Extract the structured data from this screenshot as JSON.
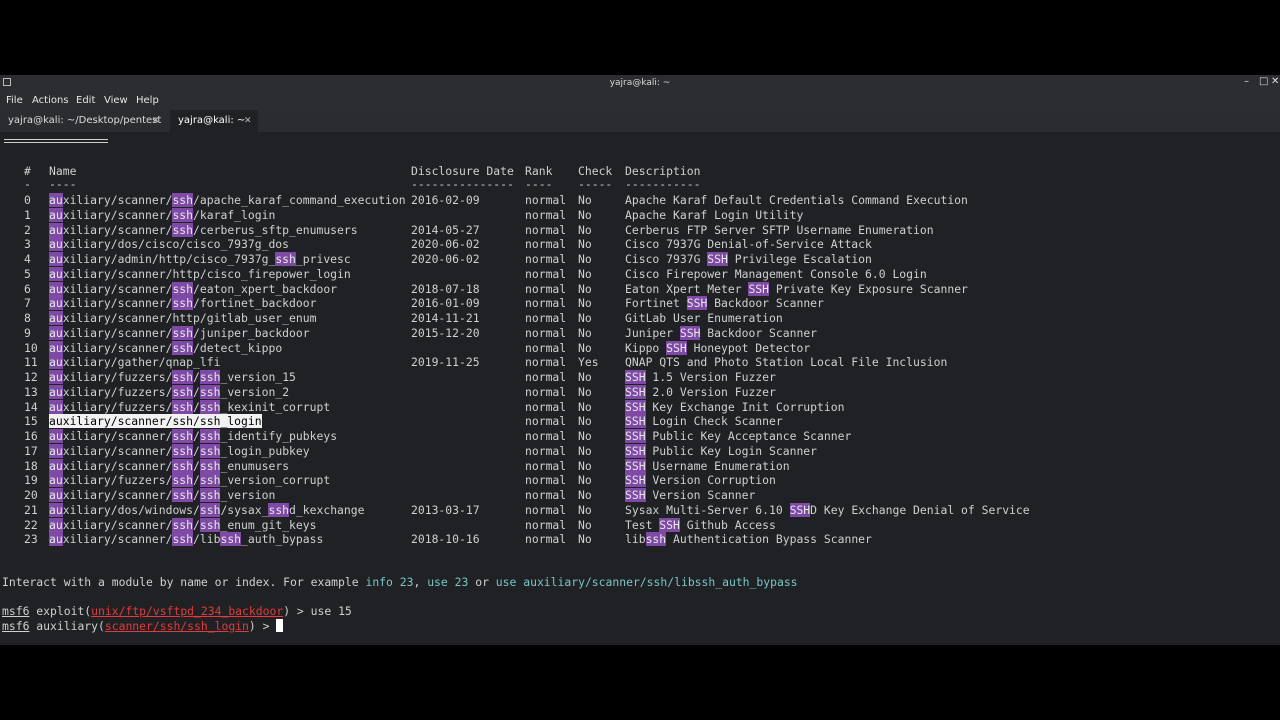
{
  "window": {
    "title": "yajra@kali: ~"
  },
  "menu": [
    "File",
    "Actions",
    "Edit",
    "View",
    "Help"
  ],
  "tabs": [
    {
      "label": "yajra@kali: ~/Desktop/pentest"
    },
    {
      "label": "yajra@kali: ~"
    }
  ],
  "table": {
    "headers": {
      "num": "#",
      "name": "Name",
      "date": "Disclosure Date",
      "rank": "Rank",
      "check": "Check",
      "desc": "Description"
    },
    "header_under": {
      "num": "-",
      "name": "----",
      "date": "---------------",
      "rank": "----",
      "check": "-----",
      "desc": "-----------"
    },
    "rows": [
      {
        "num": "0",
        "name": [
          [
            "au",
            "h"
          ],
          [
            "xiliary/scanner/",
            ""
          ],
          [
            "ssh",
            "h"
          ],
          [
            "/apache_karaf_command_execution",
            ""
          ]
        ],
        "date": "2016-02-09",
        "rank": "normal",
        "check": "No",
        "desc": [
          [
            "Apache Karaf Default Credentials Command Execution",
            ""
          ]
        ]
      },
      {
        "num": "1",
        "name": [
          [
            "au",
            "h"
          ],
          [
            "xiliary/scanner/",
            ""
          ],
          [
            "ssh",
            "h"
          ],
          [
            "/karaf_login",
            ""
          ]
        ],
        "date": "",
        "rank": "normal",
        "check": "No",
        "desc": [
          [
            "Apache Karaf Login Utility",
            ""
          ]
        ]
      },
      {
        "num": "2",
        "name": [
          [
            "au",
            "h"
          ],
          [
            "xiliary/scanner/",
            ""
          ],
          [
            "ssh",
            "h"
          ],
          [
            "/cerberus_sftp_enumusers",
            ""
          ]
        ],
        "date": "2014-05-27",
        "rank": "normal",
        "check": "No",
        "desc": [
          [
            "Cerberus FTP Server SFTP Username Enumeration",
            ""
          ]
        ]
      },
      {
        "num": "3",
        "name": [
          [
            "au",
            "h"
          ],
          [
            "xiliary/dos/cisco/cisco_7937g_dos",
            ""
          ]
        ],
        "date": "2020-06-02",
        "rank": "normal",
        "check": "No",
        "desc": [
          [
            "Cisco 7937G Denial-of-Service Attack",
            ""
          ]
        ]
      },
      {
        "num": "4",
        "name": [
          [
            "au",
            "h"
          ],
          [
            "xiliary/admin/http/cisco_7937g_",
            ""
          ],
          [
            "ssh",
            "h"
          ],
          [
            "_privesc",
            ""
          ]
        ],
        "date": "2020-06-02",
        "rank": "normal",
        "check": "No",
        "desc": [
          [
            "Cisco 7937G ",
            ""
          ],
          [
            "SSH",
            "h"
          ],
          [
            " Privilege Escalation",
            ""
          ]
        ]
      },
      {
        "num": "5",
        "name": [
          [
            "au",
            "h"
          ],
          [
            "xiliary/scanner/http/cisco_firepower_login",
            ""
          ]
        ],
        "date": "",
        "rank": "normal",
        "check": "No",
        "desc": [
          [
            "Cisco Firepower Management Console 6.0 Login",
            ""
          ]
        ]
      },
      {
        "num": "6",
        "name": [
          [
            "au",
            "h"
          ],
          [
            "xiliary/scanner/",
            ""
          ],
          [
            "ssh",
            "h"
          ],
          [
            "/eaton_xpert_backdoor",
            ""
          ]
        ],
        "date": "2018-07-18",
        "rank": "normal",
        "check": "No",
        "desc": [
          [
            "Eaton Xpert Meter ",
            ""
          ],
          [
            "SSH",
            "h"
          ],
          [
            " Private Key Exposure Scanner",
            ""
          ]
        ]
      },
      {
        "num": "7",
        "name": [
          [
            "au",
            "h"
          ],
          [
            "xiliary/scanner/",
            ""
          ],
          [
            "ssh",
            "h"
          ],
          [
            "/fortinet_backdoor",
            ""
          ]
        ],
        "date": "2016-01-09",
        "rank": "normal",
        "check": "No",
        "desc": [
          [
            "Fortinet ",
            ""
          ],
          [
            "SSH",
            "h"
          ],
          [
            " Backdoor Scanner",
            ""
          ]
        ]
      },
      {
        "num": "8",
        "name": [
          [
            "au",
            "h"
          ],
          [
            "xiliary/scanner/http/gitlab_user_enum",
            ""
          ]
        ],
        "date": "2014-11-21",
        "rank": "normal",
        "check": "No",
        "desc": [
          [
            "GitLab User Enumeration",
            ""
          ]
        ]
      },
      {
        "num": "9",
        "name": [
          [
            "au",
            "h"
          ],
          [
            "xiliary/scanner/",
            ""
          ],
          [
            "ssh",
            "h"
          ],
          [
            "/juniper_backdoor",
            ""
          ]
        ],
        "date": "2015-12-20",
        "rank": "normal",
        "check": "No",
        "desc": [
          [
            "Juniper ",
            ""
          ],
          [
            "SSH",
            "h"
          ],
          [
            " Backdoor Scanner",
            ""
          ]
        ]
      },
      {
        "num": "10",
        "name": [
          [
            "au",
            "h"
          ],
          [
            "xiliary/scanner/",
            ""
          ],
          [
            "ssh",
            "h"
          ],
          [
            "/detect_kippo",
            ""
          ]
        ],
        "date": "",
        "rank": "normal",
        "check": "No",
        "desc": [
          [
            "Kippo ",
            ""
          ],
          [
            "SSH",
            "h"
          ],
          [
            " Honeypot Detector",
            ""
          ]
        ]
      },
      {
        "num": "11",
        "name": [
          [
            "au",
            "h"
          ],
          [
            "xiliary/gather/qnap_lfi",
            ""
          ]
        ],
        "date": "2019-11-25",
        "rank": "normal",
        "check": "Yes",
        "desc": [
          [
            "QNAP QTS and Photo Station Local File Inclusion",
            ""
          ]
        ]
      },
      {
        "num": "12",
        "name": [
          [
            "au",
            "h"
          ],
          [
            "xiliary/fuzzers/",
            ""
          ],
          [
            "ssh",
            "h"
          ],
          [
            "/",
            ""
          ],
          [
            "ssh",
            "h"
          ],
          [
            "_version_15",
            ""
          ]
        ],
        "date": "",
        "rank": "normal",
        "check": "No",
        "desc": [
          [
            "SSH",
            "h"
          ],
          [
            " 1.5 Version Fuzzer",
            ""
          ]
        ]
      },
      {
        "num": "13",
        "name": [
          [
            "au",
            "h"
          ],
          [
            "xiliary/fuzzers/",
            ""
          ],
          [
            "ssh",
            "h"
          ],
          [
            "/",
            ""
          ],
          [
            "ssh",
            "h"
          ],
          [
            "_version_2",
            ""
          ]
        ],
        "date": "",
        "rank": "normal",
        "check": "No",
        "desc": [
          [
            "SSH",
            "h"
          ],
          [
            " 2.0 Version Fuzzer",
            ""
          ]
        ]
      },
      {
        "num": "14",
        "name": [
          [
            "au",
            "h"
          ],
          [
            "xiliary/fuzzers/",
            ""
          ],
          [
            "ssh",
            "h"
          ],
          [
            "/",
            ""
          ],
          [
            "ssh",
            "h"
          ],
          [
            "_kexinit_corrupt",
            ""
          ]
        ],
        "date": "",
        "rank": "normal",
        "check": "No",
        "desc": [
          [
            "SSH",
            "h"
          ],
          [
            " Key Exchange Init Corruption",
            ""
          ]
        ]
      },
      {
        "num": "15",
        "name": [
          [
            "auxiliary/scanner/ssh/ssh_login",
            "s"
          ]
        ],
        "date": "",
        "rank": "normal",
        "check": "No",
        "desc": [
          [
            "SSH",
            "h"
          ],
          [
            " Login Check Scanner",
            ""
          ]
        ]
      },
      {
        "num": "16",
        "name": [
          [
            "au",
            "h"
          ],
          [
            "xiliary/scanner/",
            ""
          ],
          [
            "ssh",
            "h"
          ],
          [
            "/",
            ""
          ],
          [
            "ssh",
            "h"
          ],
          [
            "_identify_pubkeys",
            ""
          ]
        ],
        "date": "",
        "rank": "normal",
        "check": "No",
        "desc": [
          [
            "SSH",
            "h"
          ],
          [
            " Public Key Acceptance Scanner",
            ""
          ]
        ]
      },
      {
        "num": "17",
        "name": [
          [
            "au",
            "h"
          ],
          [
            "xiliary/scanner/",
            ""
          ],
          [
            "ssh",
            "h"
          ],
          [
            "/",
            ""
          ],
          [
            "ssh",
            "h"
          ],
          [
            "_login_pubkey",
            ""
          ]
        ],
        "date": "",
        "rank": "normal",
        "check": "No",
        "desc": [
          [
            "SSH",
            "h"
          ],
          [
            " Public Key Login Scanner",
            ""
          ]
        ]
      },
      {
        "num": "18",
        "name": [
          [
            "au",
            "h"
          ],
          [
            "xiliary/scanner/",
            ""
          ],
          [
            "ssh",
            "h"
          ],
          [
            "/",
            ""
          ],
          [
            "ssh",
            "h"
          ],
          [
            "_enumusers",
            ""
          ]
        ],
        "date": "",
        "rank": "normal",
        "check": "No",
        "desc": [
          [
            "SSH",
            "h"
          ],
          [
            " Username Enumeration",
            ""
          ]
        ]
      },
      {
        "num": "19",
        "name": [
          [
            "au",
            "h"
          ],
          [
            "xiliary/fuzzers/",
            ""
          ],
          [
            "ssh",
            "h"
          ],
          [
            "/",
            ""
          ],
          [
            "ssh",
            "h"
          ],
          [
            "_version_corrupt",
            ""
          ]
        ],
        "date": "",
        "rank": "normal",
        "check": "No",
        "desc": [
          [
            "SSH",
            "h"
          ],
          [
            " Version Corruption",
            ""
          ]
        ]
      },
      {
        "num": "20",
        "name": [
          [
            "au",
            "h"
          ],
          [
            "xiliary/scanner/",
            ""
          ],
          [
            "ssh",
            "h"
          ],
          [
            "/",
            ""
          ],
          [
            "ssh",
            "h"
          ],
          [
            "_version",
            ""
          ]
        ],
        "date": "",
        "rank": "normal",
        "check": "No",
        "desc": [
          [
            "SSH",
            "h"
          ],
          [
            " Version Scanner",
            ""
          ]
        ]
      },
      {
        "num": "21",
        "name": [
          [
            "au",
            "h"
          ],
          [
            "xiliary/dos/windows/",
            ""
          ],
          [
            "ssh",
            "h"
          ],
          [
            "/sysax_",
            ""
          ],
          [
            "ssh",
            "h"
          ],
          [
            "d_kexchange",
            ""
          ]
        ],
        "date": "2013-03-17",
        "rank": "normal",
        "check": "No",
        "desc": [
          [
            "Sysax Multi-Server 6.10 ",
            ""
          ],
          [
            "SSH",
            "h"
          ],
          [
            "D Key Exchange Denial of Service",
            ""
          ]
        ]
      },
      {
        "num": "22",
        "name": [
          [
            "au",
            "h"
          ],
          [
            "xiliary/scanner/",
            ""
          ],
          [
            "ssh",
            "h"
          ],
          [
            "/",
            ""
          ],
          [
            "ssh",
            "h"
          ],
          [
            "_enum_git_keys",
            ""
          ]
        ],
        "date": "",
        "rank": "normal",
        "check": "No",
        "desc": [
          [
            "Test ",
            ""
          ],
          [
            "SSH",
            "h"
          ],
          [
            " Github Access",
            ""
          ]
        ]
      },
      {
        "num": "23",
        "name": [
          [
            "au",
            "h"
          ],
          [
            "xiliary/scanner/",
            ""
          ],
          [
            "ssh",
            "h"
          ],
          [
            "/lib",
            ""
          ],
          [
            "ssh",
            "h"
          ],
          [
            "_auth_bypass",
            ""
          ]
        ],
        "date": "2018-10-16",
        "rank": "normal",
        "check": "No",
        "desc": [
          [
            "lib",
            ""
          ],
          [
            "ssh",
            "h"
          ],
          [
            " Authentication Bypass Scanner",
            ""
          ]
        ]
      }
    ]
  },
  "interact": {
    "prefix": "Interact with a module by name or index. For example ",
    "info": "info 23",
    "sep1": ", ",
    "use": "use 23",
    "sep2": " or ",
    "use_full": "use auxiliary/scanner/ssh/libssh_auth_bypass"
  },
  "prompt1": {
    "msf": "msf6",
    "ctx": " exploit(",
    "mod": "unix/ftp/vsftpd_234_backdoor",
    "end": ") > ",
    "cmd": "use 15"
  },
  "prompt2": {
    "msf": "msf6",
    "ctx": " auxiliary(",
    "mod": "scanner/ssh/ssh_login",
    "end": ") > "
  },
  "colors": {
    "highlight": "#7e4aa6",
    "module": "#e23b3b",
    "link": "#79c6c6"
  }
}
